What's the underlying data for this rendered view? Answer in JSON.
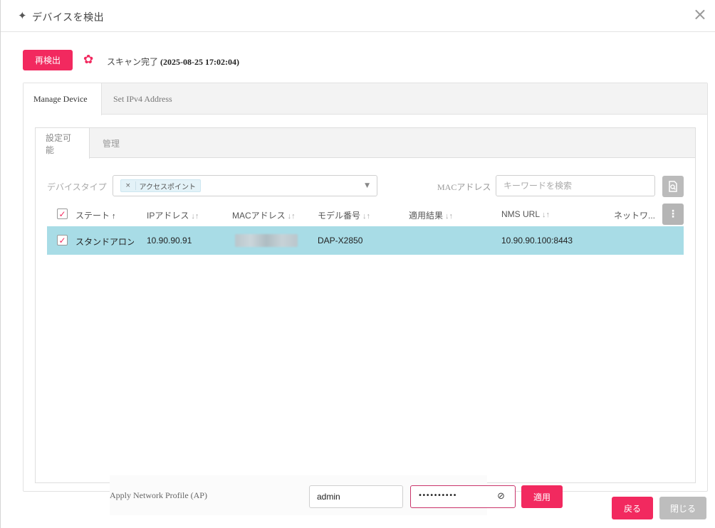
{
  "dialog": {
    "title": "デバイスを検出",
    "close_symbol": "×"
  },
  "toolbar": {
    "rescan_label": "再検出",
    "status_prefix": "スキャン完了",
    "status_time": "(2025-08-25 17:02:04)"
  },
  "outer_tabs": [
    {
      "label": "Manage Device",
      "active": true
    },
    {
      "label": "Set IPv4 Address",
      "active": false
    }
  ],
  "inner_tabs": [
    {
      "label": "設定可能",
      "active": true
    },
    {
      "label": "管理",
      "active": false
    }
  ],
  "filters": {
    "device_type_label": "デバイスタイプ",
    "device_type_chip": "アクセスポイント",
    "mac_label": "MACアドレス",
    "mac_placeholder": "キーワードを検索"
  },
  "table": {
    "headers": [
      {
        "label": "ステート",
        "sort": "↑"
      },
      {
        "label": "IPアドレス",
        "sort": "↓↑"
      },
      {
        "label": "MACアドレス",
        "sort": "↓↑"
      },
      {
        "label": "モデル番号",
        "sort": "↓↑"
      },
      {
        "label": "適用結果",
        "sort": "↓↑"
      },
      {
        "label": "NMS URL",
        "sort": "↓↑"
      },
      {
        "label": "ネットワ...",
        "sort": ""
      }
    ],
    "rows": [
      {
        "checked": true,
        "state": "スタンドアロン",
        "ip": "10.90.90.91",
        "mac": "",
        "model": "DAP-X2850",
        "result": "",
        "nms_url": "10.90.90.100:8443",
        "network": ""
      }
    ]
  },
  "profile": {
    "label": "Apply Network Profile (AP)",
    "username_value": "admin",
    "password_mask": "••••••••••",
    "apply_label": "適用"
  },
  "footer": {
    "back_label": "戻る",
    "close_label": "閉じる"
  },
  "colors": {
    "accent": "#f2295f",
    "selected_row": "#a8dce6",
    "disabled_button": "#bdbdbd"
  }
}
